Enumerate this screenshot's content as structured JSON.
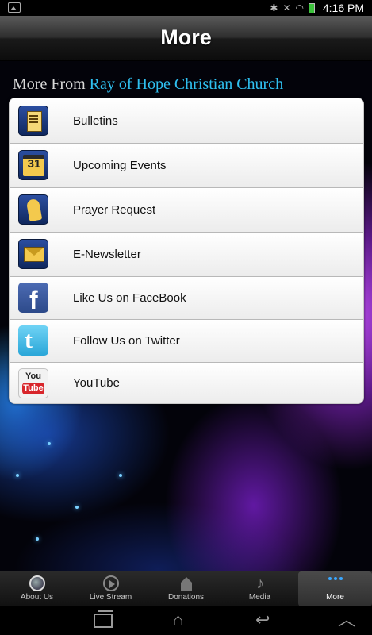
{
  "status_bar": {
    "time": "4:16 PM",
    "icons": [
      "image-icon",
      "bluetooth-icon",
      "mute-icon",
      "wifi-icon",
      "battery-icon"
    ],
    "battery_color": "#3cc23c"
  },
  "header": {
    "title": "More"
  },
  "section": {
    "heading_prefix": "More From",
    "church_name": "Ray of Hope Christian Church",
    "accent_color": "#2fc0f0"
  },
  "menu": {
    "items": [
      {
        "label": "Bulletins",
        "icon": "bulletin-icon"
      },
      {
        "label": "Upcoming Events",
        "icon": "calendar-icon",
        "icon_text": "31"
      },
      {
        "label": "Prayer Request",
        "icon": "praying-hands-icon"
      },
      {
        "label": "E-Newsletter",
        "icon": "envelope-icon"
      },
      {
        "label": "Like Us on FaceBook",
        "icon": "facebook-icon",
        "icon_text": "f"
      },
      {
        "label": "Follow Us on Twitter",
        "icon": "twitter-icon",
        "icon_text": "t"
      },
      {
        "label": "YouTube",
        "icon": "youtube-icon",
        "icon_text_top": "You",
        "icon_text_bottom": "Tube"
      }
    ]
  },
  "tabs": [
    {
      "label": "About Us",
      "icon": "globe-icon"
    },
    {
      "label": "Live Stream",
      "icon": "play-icon"
    },
    {
      "label": "Donations",
      "icon": "church-icon"
    },
    {
      "label": "Media",
      "icon": "music-note-icon"
    },
    {
      "label": "More",
      "icon": "more-dots-icon",
      "active": true
    }
  ],
  "system_nav": [
    "recent-apps-icon",
    "home-icon",
    "back-icon",
    "up-chevron-icon"
  ]
}
